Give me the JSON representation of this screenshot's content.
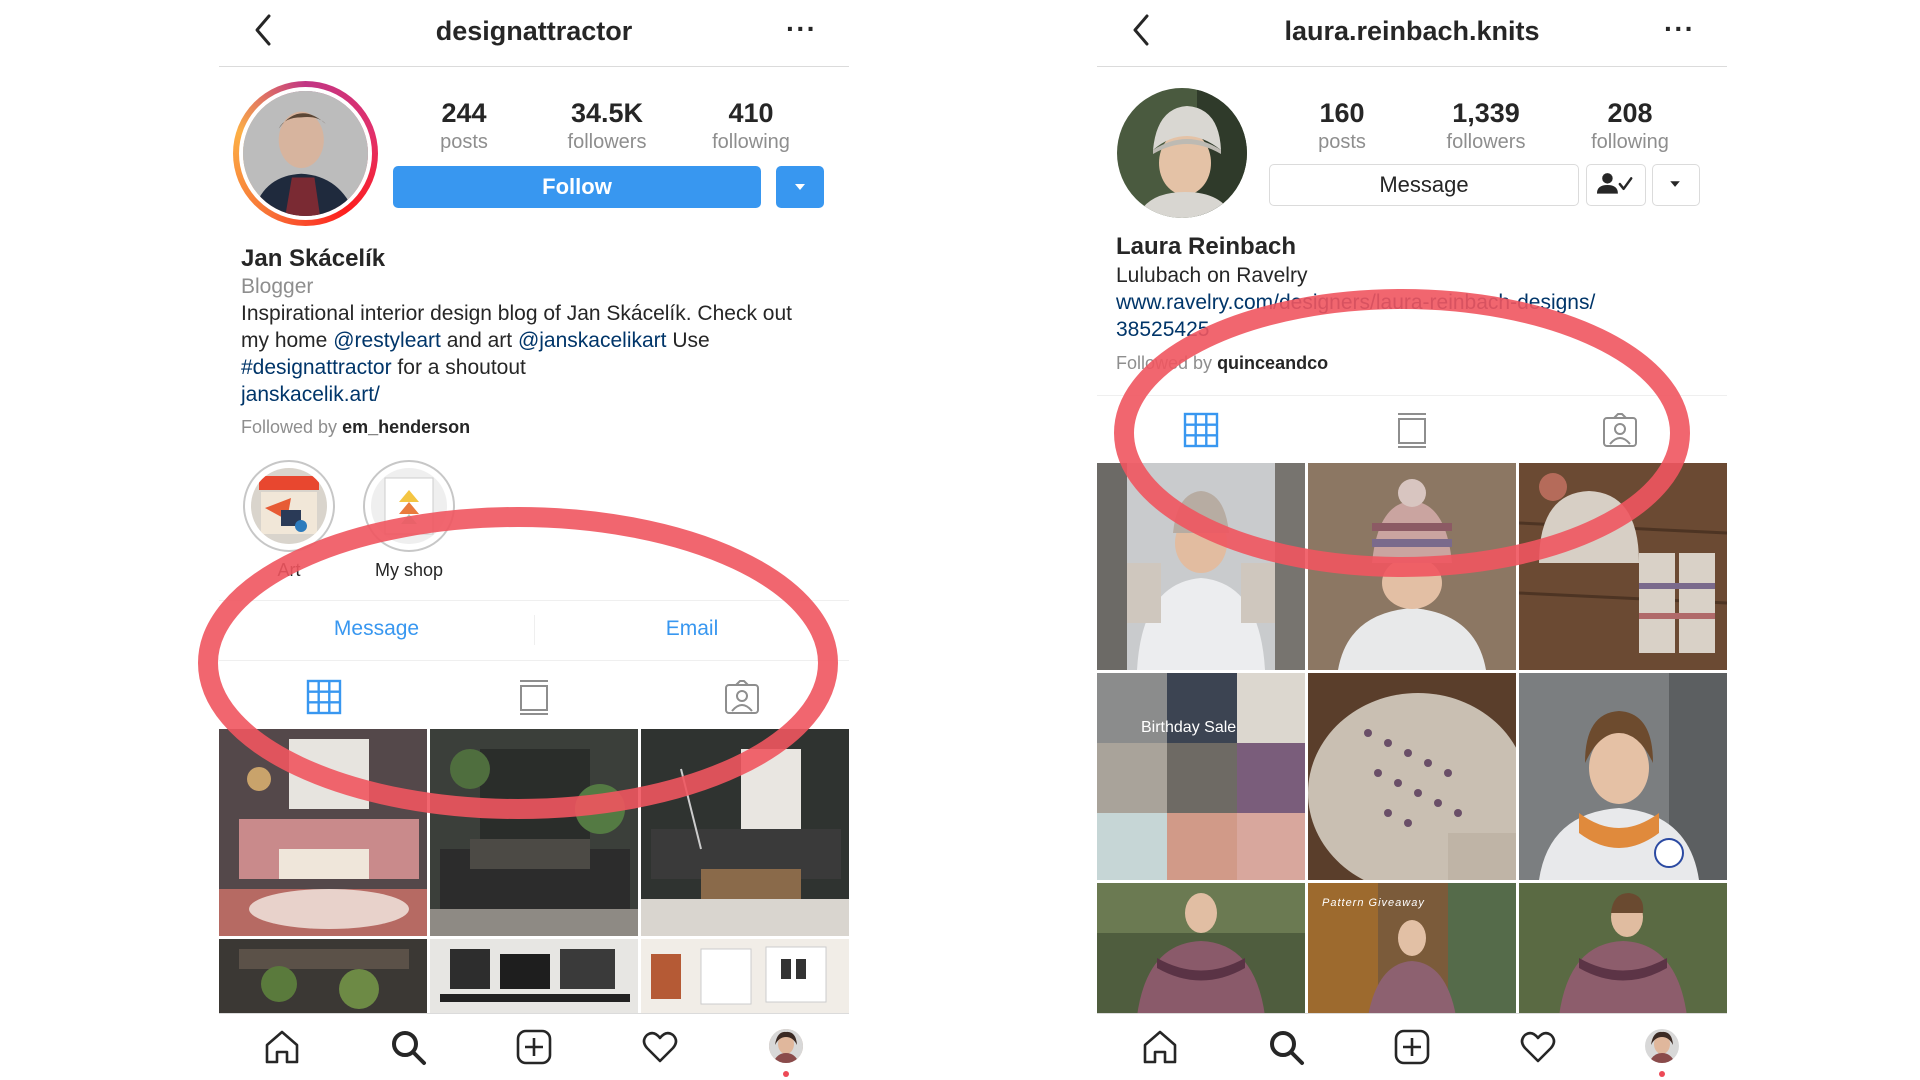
{
  "left": {
    "username": "designattractor",
    "stats": [
      {
        "num": "244",
        "label": "posts"
      },
      {
        "num": "34.5K",
        "label": "followers"
      },
      {
        "num": "410",
        "label": "following"
      }
    ],
    "follow_label": "Follow",
    "full_name": "Jan Skácelík",
    "category": "Blogger",
    "bio_line1": "Inspirational interior design blog of Jan Skácelík. Check out",
    "bio_line2_a": "my home ",
    "bio_line2_handle1": "@restyleart",
    "bio_line2_b": " and art ",
    "bio_line2_handle2": "@janskacelikart",
    "bio_line2_c": "  Use",
    "bio_line3_tag": "#designattractor",
    "bio_line3_rest": " for a shoutout",
    "website": "janskacelik.art/",
    "followed_by_prefix": "Followed by ",
    "followed_by_user": "em_henderson",
    "highlights": [
      {
        "label": "Art"
      },
      {
        "label": "My shop"
      }
    ],
    "contact": {
      "message": "Message",
      "email": "Email"
    }
  },
  "right": {
    "username": "laura.reinbach.knits",
    "stats": [
      {
        "num": "160",
        "label": "posts"
      },
      {
        "num": "1,339",
        "label": "followers"
      },
      {
        "num": "208",
        "label": "following"
      }
    ],
    "message_label": "Message",
    "full_name": "Laura Reinbach",
    "bio_line1": "Lulubach on Ravelry",
    "website_line1": "www.ravelry.com/designers/laura-reinbach-designs/",
    "website_line2": "38525425",
    "followed_by_prefix": "Followed by ",
    "followed_by_user": "quinceandco",
    "tile_texts": {
      "birthday": "Birthday Sale",
      "giveaway": "Pattern Giveaway"
    }
  },
  "colors": {
    "accent": "#3897f0",
    "highlight_circle": "#f0555f",
    "link": "#003569",
    "muted": "#8e8e8e"
  },
  "icons": [
    "back-icon",
    "more-icon",
    "grid-icon",
    "feed-icon",
    "tagged-icon",
    "home-icon",
    "search-icon",
    "add-post-icon",
    "heart-icon",
    "profile-avatar-icon",
    "dropdown-icon",
    "following-check-icon"
  ]
}
